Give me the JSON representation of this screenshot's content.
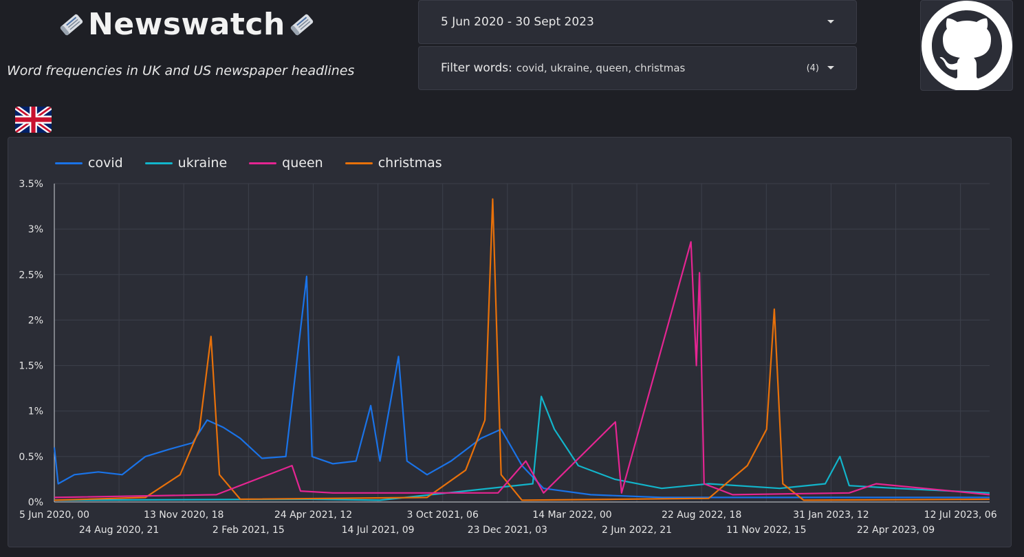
{
  "header": {
    "title": "Newswatch",
    "left_icon": "newspaper-icon",
    "right_icon": "newspaper-icon",
    "subtitle": "Word frequencies in UK and US newspaper headlines"
  },
  "date_range": {
    "label": "5 Jun 2020 - 30 Sept 2023",
    "icon": "caret-down-icon"
  },
  "filter": {
    "label": "Filter words:",
    "value": "covid, ukraine, queen, christmas",
    "count": "(4)",
    "icon": "caret-down-icon"
  },
  "github": {
    "icon": "github-icon"
  },
  "region": {
    "icon": "uk-flag-icon"
  },
  "colors": {
    "covid": "#1a73e8",
    "ukraine": "#12b5cb",
    "queen": "#e52592",
    "christmas": "#e8710a",
    "background": "#1e1f25",
    "panel": "#2b2d36"
  },
  "chart_data": {
    "type": "line",
    "title": "",
    "xlabel": "",
    "ylabel": "",
    "ylim": [
      0,
      3.5
    ],
    "y_ticks": [
      "0%",
      "0.5%",
      "1%",
      "1.5%",
      "2%",
      "2.5%",
      "3%",
      "3.5%"
    ],
    "x_range": [
      "2020-06-05",
      "2023-09-30"
    ],
    "x_ticks_row1": [
      "5 Jun 2020, 00",
      "13 Nov 2020, 18",
      "24 Apr 2021, 12",
      "3 Oct 2021, 06",
      "14 Mar 2022, 00",
      "22 Aug 2022, 18",
      "31 Jan 2023, 12",
      "12 Jul 2023, 06"
    ],
    "x_ticks_row2": [
      "24 Aug 2020, 21",
      "2 Feb 2021, 15",
      "14 Jul 2021, 09",
      "23 Dec 2021, 03",
      "2 Jun 2022, 21",
      "11 Nov 2022, 15",
      "22 Apr 2023, 09"
    ],
    "grid": true,
    "legend_position": "top-left",
    "series": [
      {
        "name": "covid",
        "points": [
          [
            "2020-06-05",
            0.6
          ],
          [
            "2020-06-10",
            0.2
          ],
          [
            "2020-07-01",
            0.3
          ],
          [
            "2020-08-01",
            0.33
          ],
          [
            "2020-09-01",
            0.3
          ],
          [
            "2020-10-01",
            0.5
          ],
          [
            "2020-11-01",
            0.58
          ],
          [
            "2020-12-01",
            0.65
          ],
          [
            "2020-12-20",
            0.9
          ],
          [
            "2021-01-10",
            0.82
          ],
          [
            "2021-02-01",
            0.7
          ],
          [
            "2021-03-01",
            0.48
          ],
          [
            "2021-04-01",
            0.5
          ],
          [
            "2021-04-28",
            2.48
          ],
          [
            "2021-05-05",
            0.5
          ],
          [
            "2021-06-01",
            0.42
          ],
          [
            "2021-07-01",
            0.45
          ],
          [
            "2021-07-20",
            1.06
          ],
          [
            "2021-08-01",
            0.45
          ],
          [
            "2021-08-25",
            1.6
          ],
          [
            "2021-09-05",
            0.45
          ],
          [
            "2021-10-01",
            0.3
          ],
          [
            "2021-11-01",
            0.45
          ],
          [
            "2021-12-10",
            0.7
          ],
          [
            "2022-01-05",
            0.8
          ],
          [
            "2022-02-01",
            0.4
          ],
          [
            "2022-03-01",
            0.15
          ],
          [
            "2022-05-01",
            0.08
          ],
          [
            "2022-08-01",
            0.05
          ],
          [
            "2023-01-01",
            0.05
          ],
          [
            "2023-06-01",
            0.05
          ],
          [
            "2023-09-30",
            0.05
          ]
        ]
      },
      {
        "name": "ukraine",
        "points": [
          [
            "2020-06-05",
            0.02
          ],
          [
            "2021-05-01",
            0.03
          ],
          [
            "2021-08-01",
            0.02
          ],
          [
            "2022-02-15",
            0.2
          ],
          [
            "2022-02-26",
            1.16
          ],
          [
            "2022-03-15",
            0.8
          ],
          [
            "2022-04-15",
            0.4
          ],
          [
            "2022-06-01",
            0.25
          ],
          [
            "2022-08-01",
            0.15
          ],
          [
            "2022-10-01",
            0.2
          ],
          [
            "2023-01-01",
            0.15
          ],
          [
            "2023-03-01",
            0.2
          ],
          [
            "2023-03-20",
            0.5
          ],
          [
            "2023-04-01",
            0.18
          ],
          [
            "2023-06-01",
            0.15
          ],
          [
            "2023-09-30",
            0.1
          ]
        ]
      },
      {
        "name": "queen",
        "points": [
          [
            "2020-06-05",
            0.05
          ],
          [
            "2021-01-01",
            0.08
          ],
          [
            "2021-04-09",
            0.4
          ],
          [
            "2021-04-20",
            0.12
          ],
          [
            "2021-06-01",
            0.1
          ],
          [
            "2022-01-01",
            0.1
          ],
          [
            "2022-02-06",
            0.45
          ],
          [
            "2022-03-01",
            0.1
          ],
          [
            "2022-06-02",
            0.88
          ],
          [
            "2022-06-10",
            0.1
          ],
          [
            "2022-09-08",
            2.86
          ],
          [
            "2022-09-15",
            1.5
          ],
          [
            "2022-09-19",
            2.52
          ],
          [
            "2022-09-25",
            0.2
          ],
          [
            "2022-11-01",
            0.08
          ],
          [
            "2023-04-01",
            0.1
          ],
          [
            "2023-05-06",
            0.2
          ],
          [
            "2023-09-30",
            0.08
          ]
        ]
      },
      {
        "name": "christmas",
        "points": [
          [
            "2020-06-05",
            0.02
          ],
          [
            "2020-10-01",
            0.05
          ],
          [
            "2020-11-15",
            0.3
          ],
          [
            "2020-12-10",
            0.8
          ],
          [
            "2020-12-25",
            1.82
          ],
          [
            "2021-01-05",
            0.3
          ],
          [
            "2021-02-01",
            0.03
          ],
          [
            "2021-10-01",
            0.05
          ],
          [
            "2021-11-20",
            0.35
          ],
          [
            "2021-12-15",
            0.9
          ],
          [
            "2021-12-25",
            3.33
          ],
          [
            "2022-01-05",
            0.3
          ],
          [
            "2022-02-01",
            0.02
          ],
          [
            "2022-10-01",
            0.04
          ],
          [
            "2022-11-20",
            0.4
          ],
          [
            "2022-12-15",
            0.8
          ],
          [
            "2022-12-25",
            2.12
          ],
          [
            "2023-01-05",
            0.2
          ],
          [
            "2023-02-01",
            0.02
          ],
          [
            "2023-09-30",
            0.03
          ]
        ]
      }
    ]
  }
}
